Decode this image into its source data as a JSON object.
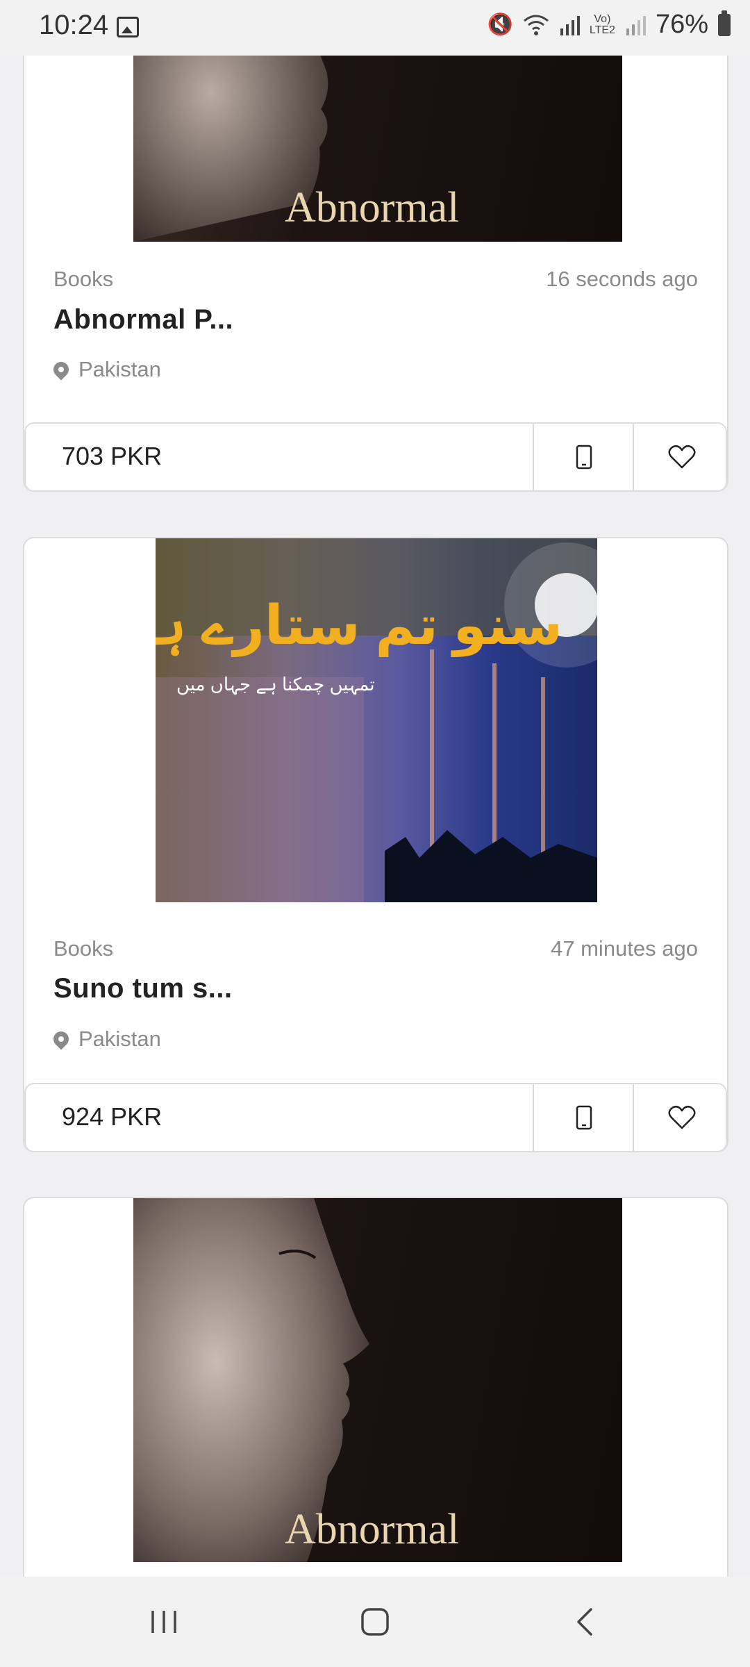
{
  "status_bar": {
    "time": "10:24",
    "battery": "76%",
    "network": "LTE2",
    "icons": [
      "image-icon",
      "mute-icon",
      "wifi-icon",
      "signal-icon",
      "volte-icon",
      "signal2-icon",
      "battery-icon"
    ]
  },
  "listings": [
    {
      "category": "Books",
      "posted": "16 seconds ago",
      "title": "Abnormal P...",
      "location": "Pakistan",
      "price": "703 PKR",
      "cover_text": "Abnormal"
    },
    {
      "category": "Books",
      "posted": "47 minutes ago",
      "title": "Suno tum s...",
      "location": "Pakistan",
      "price": "924 PKR",
      "cover_text": "سنو تم ستارے ہو",
      "cover_subtext": "تمہیں چمکنا ہے جہاں میں"
    },
    {
      "cover_text": "Abnormal"
    }
  ],
  "nav": {
    "icons": [
      "recent-apps-icon",
      "home-icon",
      "back-icon"
    ]
  },
  "colors": {
    "background": "#f0f0f3",
    "card": "#ffffff",
    "border": "#dcdcdf",
    "muted_text": "#8a8a8a",
    "title_text": "#222222"
  }
}
